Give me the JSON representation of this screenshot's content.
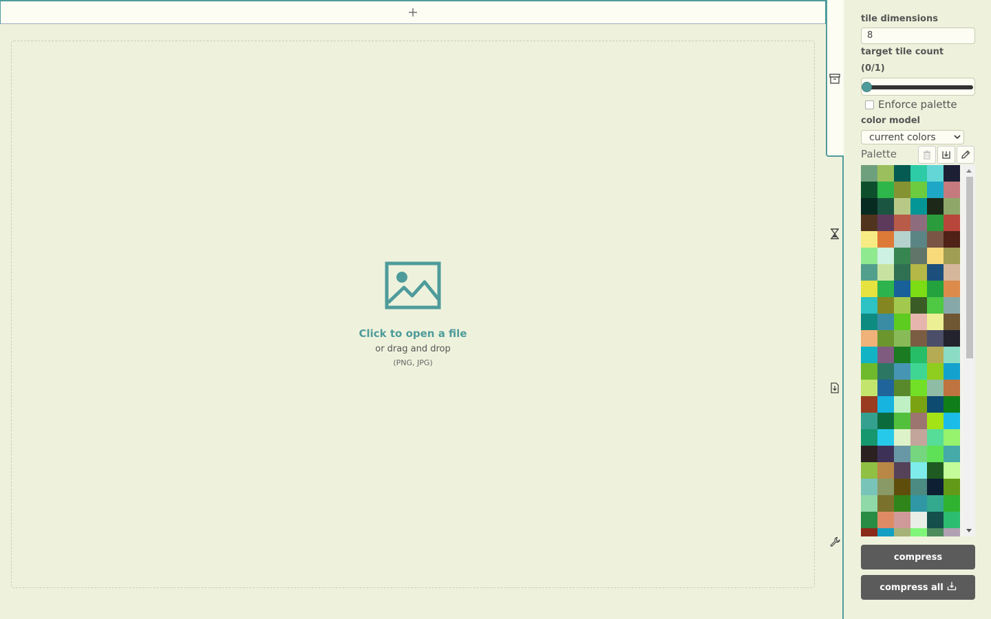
{
  "addbar": {
    "icon": "plus-icon",
    "label": "+"
  },
  "dropzone": {
    "icon": "image-icon",
    "title": "Click to open a file",
    "subtitle": "or drag and drop",
    "types": "(PNG, JPG)"
  },
  "tabs": [
    {
      "name": "archive-icon",
      "active": true
    },
    {
      "name": "hourglass-icon",
      "active": false
    },
    {
      "name": "file-download-icon",
      "active": false
    },
    {
      "name": "wrench-icon",
      "active": false
    }
  ],
  "sidebar": {
    "tile_dimensions_label": "tile dimensions",
    "tile_dimensions_value": "8",
    "target_tile_count_label": "target tile count",
    "target_tile_count_value": "(0/1)",
    "slider_value": 0,
    "enforce_palette_label": "Enforce palette",
    "enforce_palette_checked": false,
    "color_model_label": "color model",
    "color_model_value": "current colors",
    "palette_label": "Palette",
    "palette_buttons": [
      "trash-icon",
      "download-icon",
      "pencil-icon"
    ],
    "compress_label": "compress",
    "compress_all_label": "compress all"
  },
  "palette": [
    "#6fa07e",
    "#9cbf5e",
    "#055b52",
    "#2ecca6",
    "#64d6d6",
    "#1d1f35",
    "#0d4f2c",
    "#2eb64a",
    "#869332",
    "#6ccb3f",
    "#1ea7c6",
    "#c57b7d",
    "#072a21",
    "#1a5541",
    "#b8c987",
    "#049696",
    "#1d2818",
    "#8fa869",
    "#51341e",
    "#5d3a5c",
    "#b85b48",
    "#8d6d7d",
    "#2b9c3b",
    "#b8463a",
    "#f7ec84",
    "#de7a37",
    "#b6d2cd",
    "#5b8585",
    "#7a5445",
    "#4f2117",
    "#8fea8f",
    "#cdf1e2",
    "#378651",
    "#617569",
    "#f8da7a",
    "#a09d55",
    "#539f8d",
    "#c8e3a1",
    "#307052",
    "#b5b747",
    "#1c4f7c",
    "#d5b89b",
    "#e6e23f",
    "#2cb34e",
    "#18609a",
    "#7cdd15",
    "#23a23e",
    "#dc8b4b",
    "#2dc2c4",
    "#848721",
    "#a2c84d",
    "#3a5b26",
    "#4fc843",
    "#87a8a8",
    "#0e8b80",
    "#3a8ca5",
    "#5dcb1f",
    "#e6b6ae",
    "#ecef94",
    "#6f5734",
    "#f1b279",
    "#6b962e",
    "#88bb58",
    "#7a5d43",
    "#4a4e68",
    "#23232d",
    "#12b3c4",
    "#7f5b80",
    "#1a7b22",
    "#27be68",
    "#b6ab55",
    "#8bdcc5",
    "#6eba2c",
    "#2c7664",
    "#4795b4",
    "#3fd693",
    "#8fce1e",
    "#13a2cd",
    "#c3e56d",
    "#1f649a",
    "#588a2b",
    "#72e027",
    "#8fbca4",
    "#bf733f",
    "#993c1f",
    "#17b4df",
    "#bff0c4",
    "#7ba212",
    "#0e4b71",
    "#0f7e19",
    "#34a090",
    "#0c6b3c",
    "#53c03d",
    "#9c7470",
    "#a4e416",
    "#1cbce8",
    "#17976d",
    "#27c9ea",
    "#def2c9",
    "#c4a59b",
    "#56dd97",
    "#97f26d",
    "#2b2121",
    "#3e3158",
    "#6898a6",
    "#76d67f",
    "#5ee156",
    "#45aaa8",
    "#8fc044",
    "#ba8846",
    "#554258",
    "#7decea",
    "#1e5a21",
    "#c3fc99",
    "#79c4b9",
    "#899a66",
    "#5f4d0b",
    "#4b8b81",
    "#0d1f33",
    "#629a18",
    "#8fd8a7",
    "#7a722c",
    "#2f851a",
    "#3097a5",
    "#33a98d",
    "#30b231",
    "#298c45",
    "#de8b65",
    "#d09a9a",
    "#e9efe7",
    "#154f4b",
    "#2dbd70",
    "#892a1b",
    "#139fc3",
    "#a6b277",
    "#7ff678",
    "#4c8b5c",
    "#b1a0b2"
  ]
}
